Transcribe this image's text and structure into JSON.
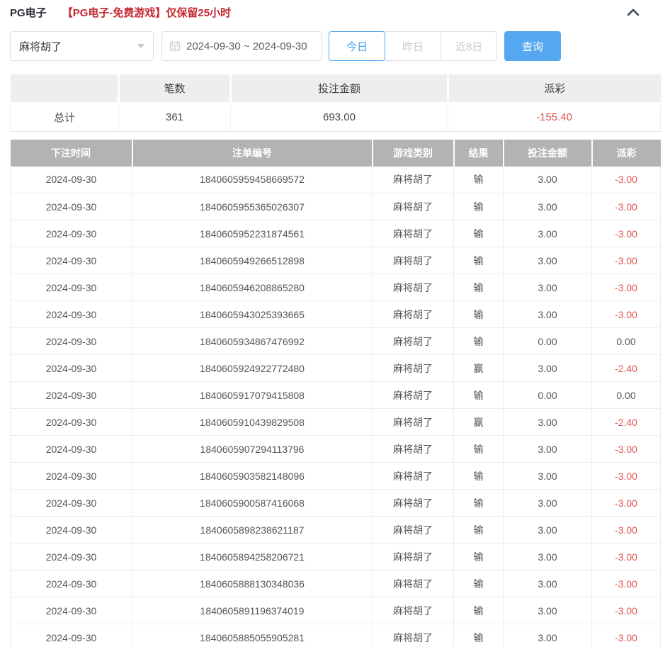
{
  "header": {
    "title": "PG电子",
    "notice": "【PG电子-免费游戏】仅保留25小时"
  },
  "filters": {
    "game_select": {
      "value": "麻将胡了"
    },
    "date_range": {
      "value": "2024-09-30 ~ 2024-09-30"
    },
    "quick_buttons": [
      {
        "label": "今日",
        "active": true
      },
      {
        "label": "昨日",
        "active": false
      },
      {
        "label": "近8日",
        "active": false
      }
    ],
    "query_button_label": "查询"
  },
  "summary": {
    "columns": [
      "",
      "笔数",
      "投注金额",
      "派彩"
    ],
    "row_label": "总计",
    "count": "361",
    "bet_amount": "693.00",
    "payout": "-155.40"
  },
  "table": {
    "columns": [
      "下注时间",
      "注单编号",
      "游戏类别",
      "结果",
      "投注金额",
      "派彩"
    ],
    "rows": [
      {
        "time": "2024-09-30",
        "order_no": "1840605959458669572",
        "game": "麻将胡了",
        "result": "输",
        "bet": "3.00",
        "payout": "-3.00",
        "neg": true
      },
      {
        "time": "2024-09-30",
        "order_no": "1840605955365026307",
        "game": "麻将胡了",
        "result": "输",
        "bet": "3.00",
        "payout": "-3.00",
        "neg": true
      },
      {
        "time": "2024-09-30",
        "order_no": "1840605952231874561",
        "game": "麻将胡了",
        "result": "输",
        "bet": "3.00",
        "payout": "-3.00",
        "neg": true
      },
      {
        "time": "2024-09-30",
        "order_no": "1840605949266512898",
        "game": "麻将胡了",
        "result": "输",
        "bet": "3.00",
        "payout": "-3.00",
        "neg": true
      },
      {
        "time": "2024-09-30",
        "order_no": "1840605946208865280",
        "game": "麻将胡了",
        "result": "输",
        "bet": "3.00",
        "payout": "-3.00",
        "neg": true
      },
      {
        "time": "2024-09-30",
        "order_no": "1840605943025393665",
        "game": "麻将胡了",
        "result": "输",
        "bet": "3.00",
        "payout": "-3.00",
        "neg": true
      },
      {
        "time": "2024-09-30",
        "order_no": "1840605934867476992",
        "game": "麻将胡了",
        "result": "输",
        "bet": "0.00",
        "payout": "0.00",
        "neg": false
      },
      {
        "time": "2024-09-30",
        "order_no": "1840605924922772480",
        "game": "麻将胡了",
        "result": "赢",
        "bet": "3.00",
        "payout": "-2.40",
        "neg": true
      },
      {
        "time": "2024-09-30",
        "order_no": "1840605917079415808",
        "game": "麻将胡了",
        "result": "输",
        "bet": "0.00",
        "payout": "0.00",
        "neg": false
      },
      {
        "time": "2024-09-30",
        "order_no": "1840605910439829508",
        "game": "麻将胡了",
        "result": "赢",
        "bet": "3.00",
        "payout": "-2.40",
        "neg": true
      },
      {
        "time": "2024-09-30",
        "order_no": "1840605907294113796",
        "game": "麻将胡了",
        "result": "输",
        "bet": "3.00",
        "payout": "-3.00",
        "neg": true
      },
      {
        "time": "2024-09-30",
        "order_no": "1840605903582148096",
        "game": "麻将胡了",
        "result": "输",
        "bet": "3.00",
        "payout": "-3.00",
        "neg": true
      },
      {
        "time": "2024-09-30",
        "order_no": "1840605900587416068",
        "game": "麻将胡了",
        "result": "输",
        "bet": "3.00",
        "payout": "-3.00",
        "neg": true
      },
      {
        "time": "2024-09-30",
        "order_no": "1840605898238621187",
        "game": "麻将胡了",
        "result": "输",
        "bet": "3.00",
        "payout": "-3.00",
        "neg": true
      },
      {
        "time": "2024-09-30",
        "order_no": "1840605894258206721",
        "game": "麻将胡了",
        "result": "输",
        "bet": "3.00",
        "payout": "-3.00",
        "neg": true
      },
      {
        "time": "2024-09-30",
        "order_no": "1840605888130348036",
        "game": "麻将胡了",
        "result": "输",
        "bet": "3.00",
        "payout": "-3.00",
        "neg": true
      },
      {
        "time": "2024-09-30",
        "order_no": "1840605891196374019",
        "game": "麻将胡了",
        "result": "输",
        "bet": "3.00",
        "payout": "-3.00",
        "neg": true
      },
      {
        "time": "2024-09-30",
        "order_no": "1840605885055905281",
        "game": "麻将胡了",
        "result": "输",
        "bet": "3.00",
        "payout": "-3.00",
        "neg": true
      }
    ]
  },
  "colors": {
    "accent_blue": "#55a8f0",
    "notice_red": "#c4262e",
    "negative_red": "#e05454",
    "table_header_gray": "#b3b3b3",
    "summary_header_gray": "#eeeeee"
  }
}
